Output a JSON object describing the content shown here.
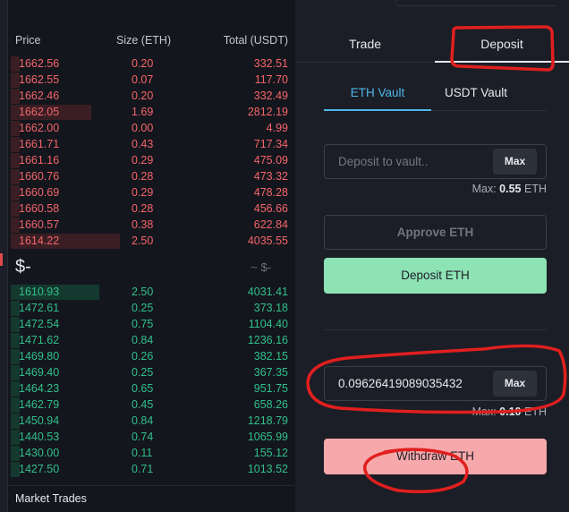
{
  "orderbook": {
    "headers": {
      "price": "Price",
      "size": "Size (ETH)",
      "total": "Total (USDT)"
    },
    "asks": [
      {
        "price": "1662.56",
        "size": "0.20",
        "total": "332.51",
        "depth": 0.03
      },
      {
        "price": "1662.55",
        "size": "0.07",
        "total": "117.70",
        "depth": 0.03
      },
      {
        "price": "1662.46",
        "total": "332.49",
        "size": "0.20",
        "depth": 0.03
      },
      {
        "price": "1662.05",
        "size": "1.69",
        "total": "2812.19",
        "depth": 0.28
      },
      {
        "price": "1662.00",
        "size": "0.00",
        "total": "4.99",
        "depth": 0.03
      },
      {
        "price": "1661.71",
        "size": "0.43",
        "total": "717.34",
        "depth": 0.03
      },
      {
        "price": "1661.16",
        "size": "0.29",
        "total": "475.09",
        "depth": 0.03
      },
      {
        "price": "1660.76",
        "size": "0.28",
        "total": "473.32",
        "depth": 0.03
      },
      {
        "price": "1660.69",
        "size": "0.29",
        "total": "478.28",
        "depth": 0.03
      },
      {
        "price": "1660.58",
        "size": "0.28",
        "total": "456.66",
        "depth": 0.03
      },
      {
        "price": "1660.57",
        "size": "0.38",
        "total": "622.84",
        "depth": 0.03
      },
      {
        "price": "1614.22",
        "size": "2.50",
        "total": "4035.55",
        "depth": 0.38
      }
    ],
    "mid_price": "$-",
    "mid_usd": "~ $-",
    "bids": [
      {
        "price": "1610.93",
        "size": "2.50",
        "total": "4031.41",
        "depth": 0.31
      },
      {
        "price": "1472.61",
        "size": "0.25",
        "total": "373.18",
        "depth": 0.03
      },
      {
        "price": "1472.54",
        "size": "0.75",
        "total": "1104.40",
        "depth": 0.03
      },
      {
        "price": "1471.62",
        "size": "0.84",
        "total": "1236.16",
        "depth": 0.03
      },
      {
        "price": "1469.80",
        "size": "0.26",
        "total": "382.15",
        "depth": 0.03
      },
      {
        "price": "1469.40",
        "size": "0.25",
        "total": "367.35",
        "depth": 0.03
      },
      {
        "price": "1464.23",
        "size": "0.65",
        "total": "951.75",
        "depth": 0.03
      },
      {
        "price": "1462.79",
        "size": "0.45",
        "total": "658.26",
        "depth": 0.03
      },
      {
        "price": "1450.94",
        "size": "0.84",
        "total": "1218.79",
        "depth": 0.03
      },
      {
        "price": "1440.53",
        "size": "0.74",
        "total": "1065.99",
        "depth": 0.03
      },
      {
        "price": "1430.00",
        "size": "0.11",
        "total": "155.12",
        "depth": 0.03
      },
      {
        "price": "1427.50",
        "size": "0.71",
        "total": "1013.52",
        "depth": 0.03
      }
    ]
  },
  "market_trades": {
    "label": "Market Trades"
  },
  "panel": {
    "tabs": {
      "trade": "Trade",
      "deposit": "Deposit"
    },
    "vault_tabs": {
      "eth": "ETH Vault",
      "usdt": "USDT Vault"
    },
    "deposit_input": {
      "placeholder": "Deposit to vault..",
      "value": "",
      "max_button": "Max"
    },
    "deposit_max": {
      "label": "Max:",
      "amount": "0.55",
      "unit": "ETH"
    },
    "approve_button": "Approve ETH",
    "deposit_button": "Deposit ETH",
    "withdraw_input": {
      "placeholder": "",
      "value": "0.09626419089035432",
      "max_button": "Max"
    },
    "withdraw_max": {
      "label": "Max:",
      "amount": "0.10",
      "unit": "ETH"
    },
    "withdraw_button": "Withdraw ETH"
  },
  "colors": {
    "ask": "#f4656a",
    "bid": "#30c08a",
    "accent": "#4fb7ea",
    "deposit_button": "#8ee3b5",
    "withdraw_button": "#f7a8aa",
    "annotation": "#e11f1f"
  }
}
